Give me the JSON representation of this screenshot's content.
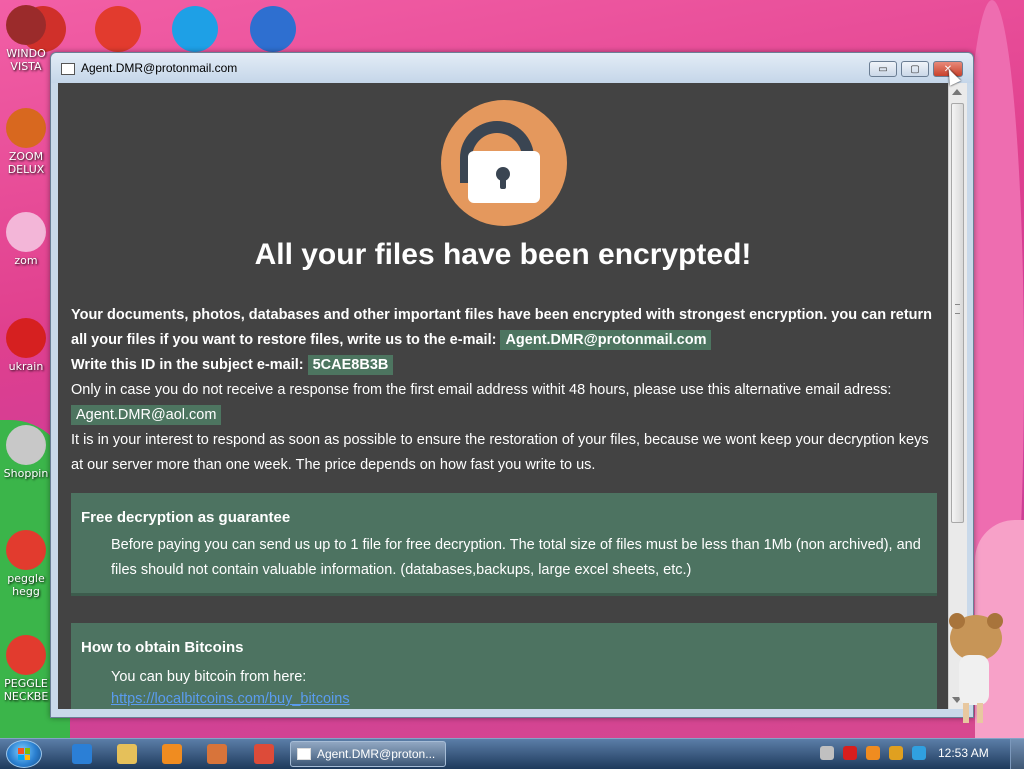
{
  "desktop": {
    "icons": [
      {
        "label": "WINDO\nVISTA",
        "icon": "windows-orb-icon",
        "color": "#9b2b2b"
      },
      {
        "label": "ZOOM\nDELUX",
        "icon": "zuma-icon",
        "color": "#d8681f"
      },
      {
        "label": "zom",
        "icon": "flower-icon",
        "color": "#f3b6d8"
      },
      {
        "label": "ukrain",
        "icon": "radiation-icon",
        "color": "#d62020"
      },
      {
        "label": "Shoppin",
        "icon": "flash-icon",
        "color": "#c8c8c8"
      },
      {
        "label": "peggle\nhegg",
        "icon": "peggle-icon",
        "color": "#e23b2e"
      },
      {
        "label": "PEGGLE\nNECKBE",
        "icon": "peggle-icon",
        "color": "#e23b2e"
      }
    ],
    "top_icons": [
      {
        "icon": "red-app-icon",
        "color": "#d0302a"
      },
      {
        "icon": "peggle-p-icon",
        "color": "#e23b2e"
      },
      {
        "icon": "skype-icon",
        "color": "#1ea0e6"
      },
      {
        "icon": "browser-globe-icon",
        "color": "#2e6fd0"
      }
    ]
  },
  "window": {
    "title": "Agent.DMR@protonmail.com",
    "min_label": "▭",
    "max_label": "▢",
    "close_label": "✕"
  },
  "ransom": {
    "headline": "All your files have been encrypted!",
    "intro_1": "Your documents, photos, databases and other important files have been encrypted with strongest encryption. you can return all your files if you want to restore files, write us to the e-mail:",
    "email_primary": "Agent.DMR@protonmail.com",
    "id_label": "Write this ID in the subject e-mail:",
    "id_value": "5CAE8B3B",
    "alt_text": "Only in case you do not receive a response from the first email address withit 48 hours, please use this alternative email adress:",
    "email_alt": "Agent.DMR@aol.com",
    "interest_text": "It is in your interest to respond as soon as possible to ensure the restoration of your files, because we wont keep your decryption keys at our server more than one week. The price depends on how fast you write to us.",
    "panels": [
      {
        "title": "Free decryption as guarantee",
        "text": "Before paying you can send us up to 1 file for free decryption. The total size of files must be less than 1Mb (non archived), and files should not contain valuable information. (databases,backups, large excel sheets, etc.)"
      },
      {
        "title": "How to obtain Bitcoins",
        "text": "You can buy bitcoin from here:",
        "link": "https://localbitcoins.com/buy_bitcoins"
      }
    ]
  },
  "taskbar": {
    "task_label": "Agent.DMR@proton...",
    "clock": "12:53 AM",
    "pinned": [
      {
        "icon": "internet-explorer-icon",
        "color": "#2b7fd6"
      },
      {
        "icon": "folder-icon",
        "color": "#e5c05a"
      },
      {
        "icon": "media-player-icon",
        "color": "#f08c20"
      },
      {
        "icon": "puzzle-app-icon",
        "color": "#d8743a"
      },
      {
        "icon": "chrome-icon",
        "color": "#dd4b39"
      }
    ],
    "tray": [
      {
        "icon": "network-icon",
        "color": "#c0c0c0"
      },
      {
        "icon": "antivirus-icon",
        "color": "#d81e1e"
      },
      {
        "icon": "search-tray-icon",
        "color": "#f08c20"
      },
      {
        "icon": "app-tray-icon",
        "color": "#e0a020"
      },
      {
        "icon": "display-tray-icon",
        "color": "#30a0e0"
      },
      {
        "icon": "volume-icon",
        "color": "#888888"
      }
    ]
  }
}
